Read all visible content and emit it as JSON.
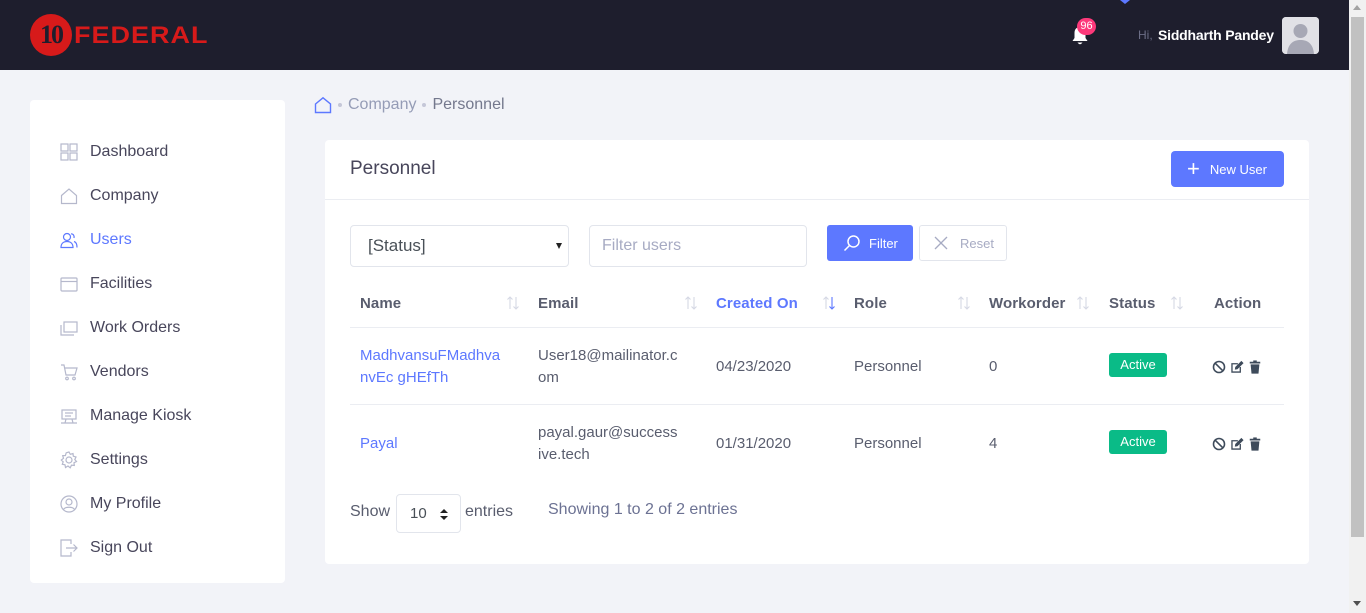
{
  "header": {
    "logo_number": "10",
    "logo_text": "FEDERAL",
    "notification_count": "96",
    "greeting": "Hi,",
    "user_name": "Siddharth Pandey"
  },
  "sidebar": {
    "items": [
      {
        "label": "Dashboard",
        "icon": "dashboard-icon"
      },
      {
        "label": "Company",
        "icon": "home-icon"
      },
      {
        "label": "Users",
        "icon": "users-icon",
        "active": true
      },
      {
        "label": "Facilities",
        "icon": "facilities-icon"
      },
      {
        "label": "Work Orders",
        "icon": "work-orders-icon"
      },
      {
        "label": "Vendors",
        "icon": "cart-icon"
      },
      {
        "label": "Manage Kiosk",
        "icon": "kiosk-icon"
      },
      {
        "label": "Settings",
        "icon": "gear-icon"
      },
      {
        "label": "My Profile",
        "icon": "profile-icon"
      },
      {
        "label": "Sign Out",
        "icon": "sign-out-icon"
      }
    ]
  },
  "breadcrumb": {
    "items": [
      "Company",
      "Personnel"
    ]
  },
  "card": {
    "title": "Personnel",
    "new_user_label": "New User"
  },
  "filters": {
    "status_value": "[Status]",
    "search_placeholder": "Filter users",
    "filter_label": "Filter",
    "reset_label": "Reset"
  },
  "table": {
    "columns": [
      "Name",
      "Email",
      "Created On",
      "Role",
      "Workorder",
      "Status",
      "Action"
    ],
    "sorted_column": "Created On",
    "rows": [
      {
        "name_line1": "MadhvansuFMadhva",
        "name_line2": "nvEc gHEfTh",
        "email_line1": "User18@mailinator.c",
        "email_line2": "om",
        "created_on": "04/23/2020",
        "role": "Personnel",
        "workorder": "0",
        "status": "Active"
      },
      {
        "name_line1": "Payal",
        "name_line2": "",
        "email_line1": "payal.gaur@success",
        "email_line2": "ive.tech",
        "created_on": "01/31/2020",
        "role": "Personnel",
        "workorder": "4",
        "status": "Active"
      }
    ]
  },
  "pagination": {
    "show_label": "Show",
    "page_length": "10",
    "entries_label": "entries",
    "info": "Showing 1 to 2 of 2 entries"
  },
  "colors": {
    "topbar": "#1e1e2d",
    "brand_red": "#d71a1a",
    "accent": "#5d78ff",
    "success": "#0abb87",
    "badge": "#fd397a"
  }
}
